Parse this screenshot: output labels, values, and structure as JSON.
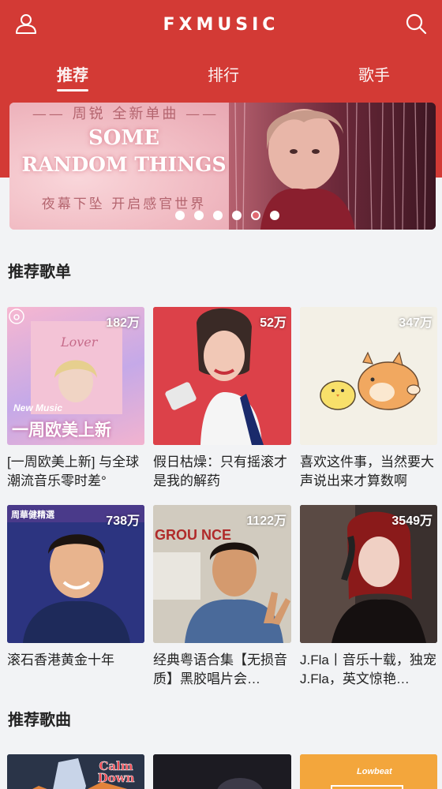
{
  "header": {
    "title": "FXMUSIC",
    "tabs": [
      "推荐",
      "排行",
      "歌手"
    ],
    "icons": {
      "left": "user-icon",
      "right": "search-icon"
    },
    "accent_color": "#d33a35"
  },
  "banner": {
    "top_line": "—— 周锐 全新单曲 ——",
    "title_line1": "SOME",
    "title_line2": "RANDOM THINGS",
    "subtitle": "夜幕下坠 开启感官世界",
    "dots_total": 6,
    "active_dot_index": 4
  },
  "playlists_section": {
    "title": "推荐歌单",
    "items": [
      {
        "count": "182万",
        "title": "[一周欧美上新] 与全球潮流音乐零时差°",
        "cover_caption_top": "New Music",
        "cover_caption_main": "一周欧美上新",
        "cover_script": "Lover"
      },
      {
        "count": "52万",
        "title": "假日枯燥：只有摇滚才是我的解药"
      },
      {
        "count": "347万",
        "title": "喜欢这件事，当然要大声说出来才算数啊"
      },
      {
        "count": "738万",
        "title": "滚石香港黄金十年",
        "cover_caption_top": "周華健精選"
      },
      {
        "count": "1122万",
        "title": "经典粤语合集【无损音质】黑胶唱片会…",
        "cover_caption_top": "GROU NCE"
      },
      {
        "count": "3549万",
        "title": "J.Fla丨音乐十载，独宠J.Fla，英文惊艳…"
      }
    ]
  },
  "songs_section": {
    "title": "推荐歌曲",
    "items": [
      {
        "cover_caption": "Calm Down"
      },
      {
        "cover_caption": ""
      },
      {
        "cover_caption": "Lowbeat"
      }
    ]
  }
}
